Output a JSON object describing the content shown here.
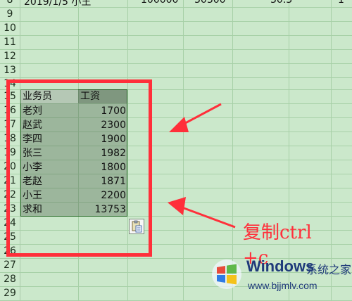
{
  "app": {
    "title": "Excel spreadsheet"
  },
  "top_row": {
    "row": "8",
    "a": "2019/1/5 小王",
    "b": "100000",
    "c": "30300",
    "d": "30.3",
    "e": "1"
  },
  "rows": [
    "8",
    "9",
    "10",
    "11",
    "12",
    "13",
    "14",
    "15",
    "16",
    "17",
    "18",
    "19",
    "20",
    "21",
    "22",
    "23",
    "24",
    "25",
    "26",
    "27",
    "28",
    "29"
  ],
  "table": {
    "header": {
      "name": "业务员",
      "salary": "工资"
    },
    "rows": [
      {
        "name": "老刘",
        "salary": "1700"
      },
      {
        "name": "赵武",
        "salary": "2300"
      },
      {
        "name": "李四",
        "salary": "1900"
      },
      {
        "name": "张三",
        "salary": "1982"
      },
      {
        "name": "小李",
        "salary": "1800"
      },
      {
        "name": "老赵",
        "salary": "1871"
      },
      {
        "name": "小王",
        "salary": "2200"
      },
      {
        "name": "求和",
        "salary": "13753"
      }
    ]
  },
  "annotation": {
    "line1": "复制ctrl",
    "line2": "+c"
  },
  "watermark": {
    "brand": "Windows",
    "cn": "系统之家",
    "url": "www.bjjmlv.com"
  },
  "colors": {
    "red": "#ff2f3a",
    "grid": "#a7d0a7",
    "bg": "#cbe8cb",
    "brand": "#1f3a7a"
  }
}
